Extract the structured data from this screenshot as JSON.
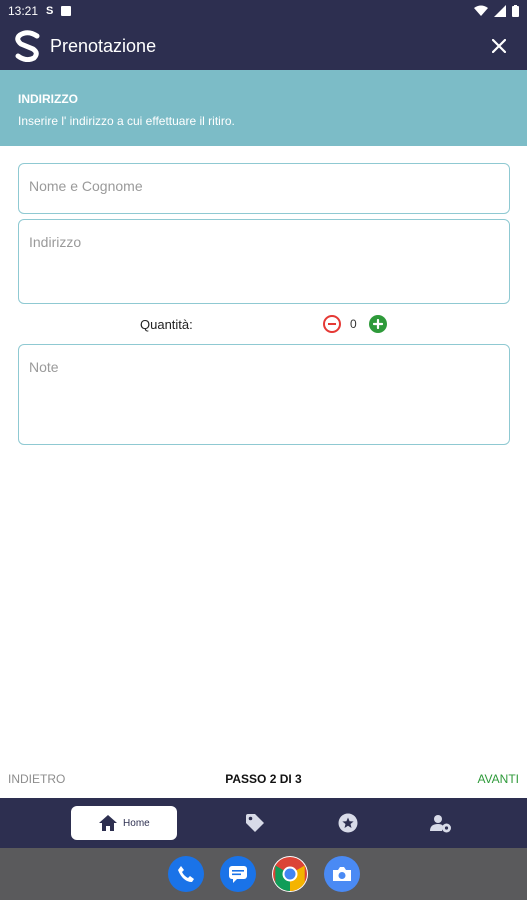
{
  "status_bar": {
    "time": "13:21",
    "s_label": "S"
  },
  "app_bar": {
    "title": "Prenotazione"
  },
  "section": {
    "title": "INDIRIZZO",
    "subtitle": "Inserire l' indirizzo a cui effettuare il ritiro."
  },
  "form": {
    "name_placeholder": "Nome e Cognome",
    "address_placeholder": "Indirizzo",
    "quantity_label": "Quantità:",
    "quantity_value": "0",
    "notes_placeholder": "Note"
  },
  "steps": {
    "back_label": "INDIETRO",
    "step_label": "PASSO 2 DI 3",
    "next_label": "AVANTI"
  },
  "bottom_nav": {
    "home_label": "Home",
    "icons": [
      "home-icon",
      "tag-icon",
      "star-badge-icon",
      "user-settings-icon"
    ]
  },
  "colors": {
    "primary_dark": "#2d2f50",
    "header_teal": "#7cbcc7",
    "field_border": "#8fc9d2",
    "accent_green": "#2e9a3a",
    "minus_red": "#e53935"
  },
  "dock": {
    "apps": [
      "phone-app-icon",
      "messages-app-icon",
      "chrome-app-icon",
      "camera-app-icon"
    ]
  }
}
